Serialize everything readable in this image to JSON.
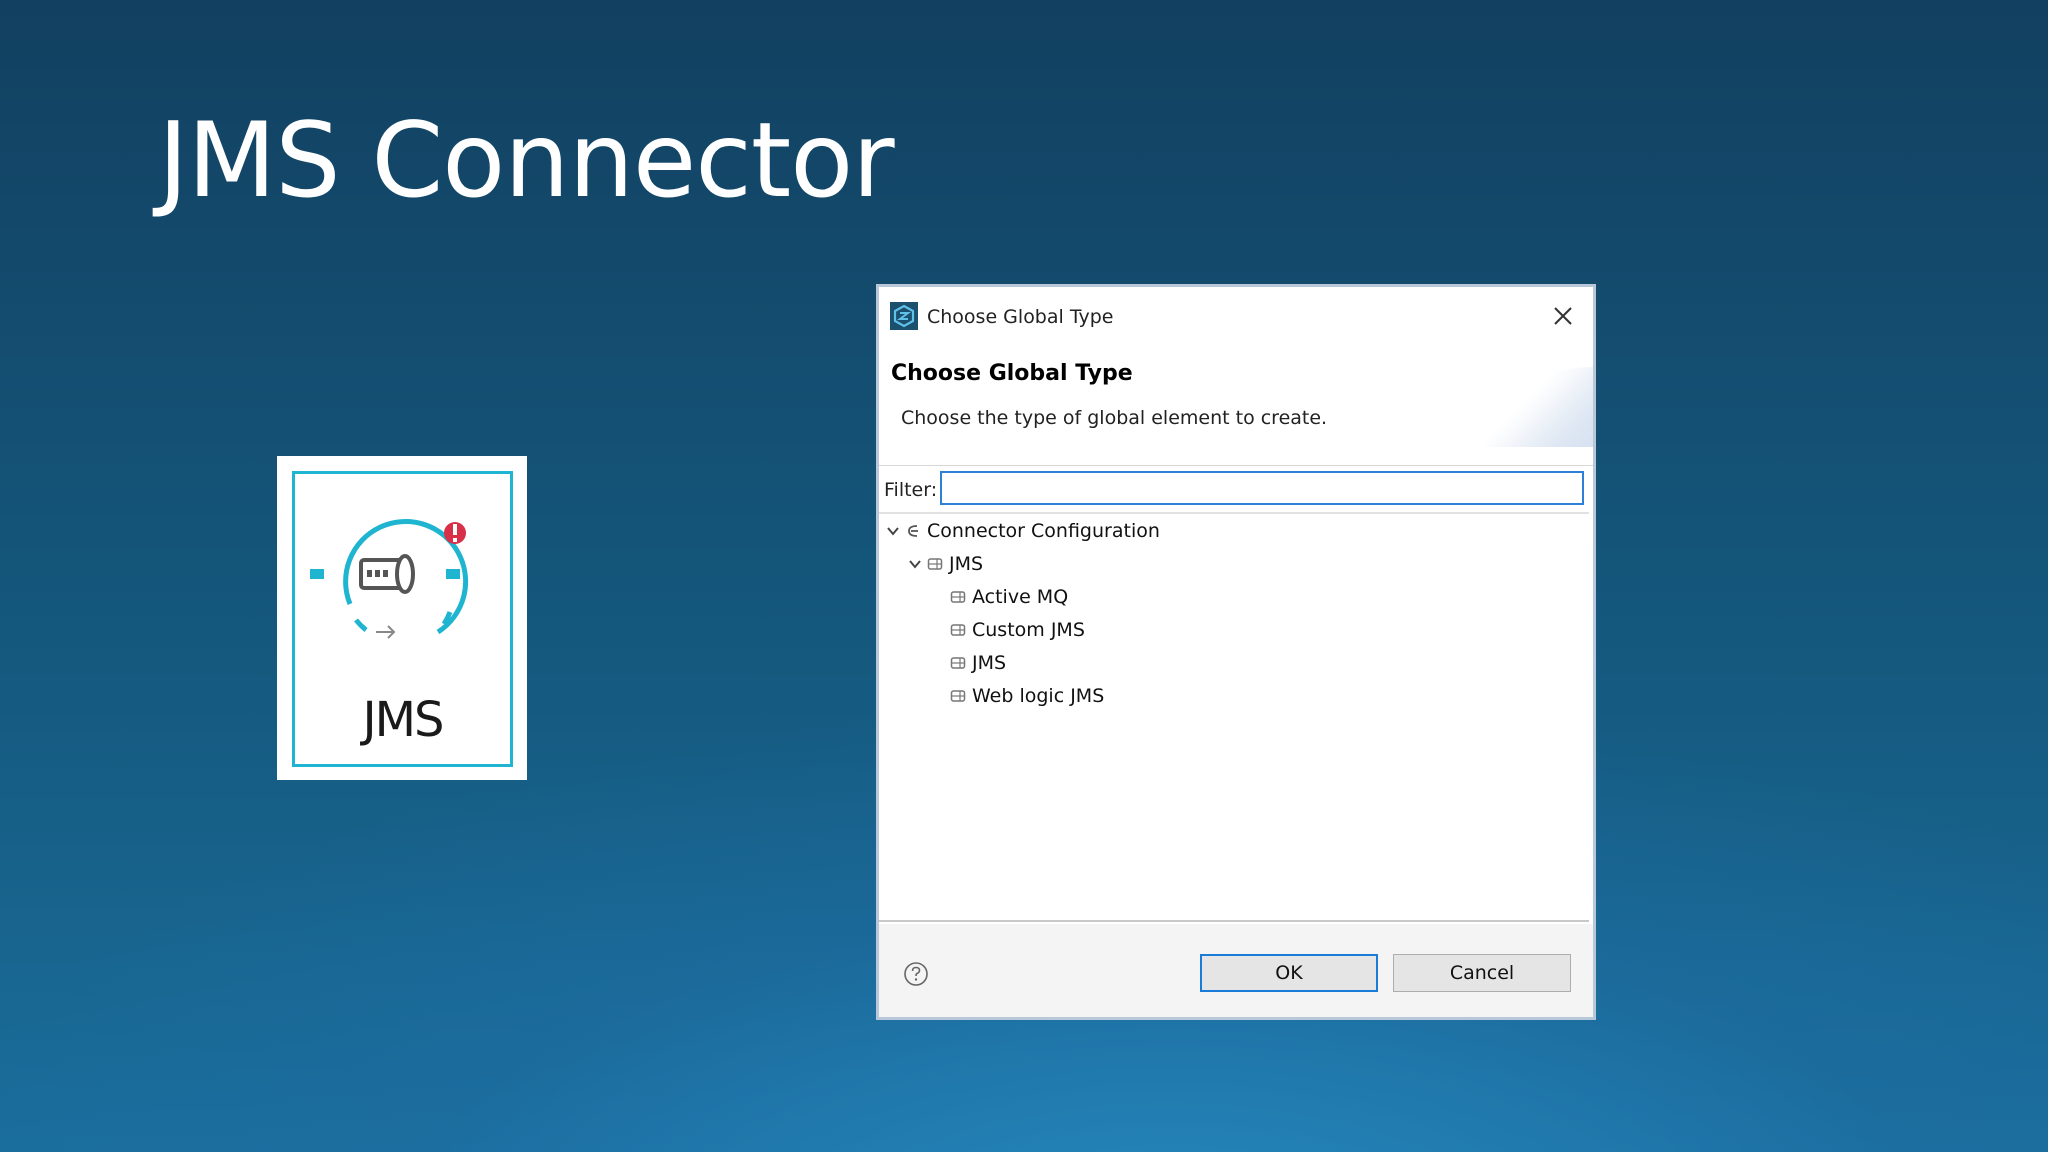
{
  "slide": {
    "title": "JMS Connector"
  },
  "connector_tile": {
    "label": "JMS",
    "icon": "jms-connector-icon",
    "badge": "error-badge-icon",
    "accent_color": "#1fb4cf"
  },
  "dialog": {
    "window_title": "Choose Global Type",
    "header_title": "Choose Global Type",
    "header_description": "Choose the type of global element to create.",
    "filter": {
      "label": "Filter:",
      "value": "",
      "placeholder": ""
    },
    "tree": [
      {
        "label": "Connector Configuration",
        "depth": 0,
        "expanded": true,
        "icon": "connector-config-icon"
      },
      {
        "label": "JMS",
        "depth": 1,
        "expanded": true,
        "icon": "config-icon"
      },
      {
        "label": "Active MQ",
        "depth": 2,
        "icon": "config-icon"
      },
      {
        "label": "Custom JMS",
        "depth": 2,
        "icon": "config-icon"
      },
      {
        "label": "JMS",
        "depth": 2,
        "icon": "config-icon"
      },
      {
        "label": "Web logic JMS",
        "depth": 2,
        "icon": "config-icon"
      }
    ],
    "buttons": {
      "ok": "OK",
      "cancel": "Cancel"
    },
    "accent_color": "#1a7bd8"
  }
}
